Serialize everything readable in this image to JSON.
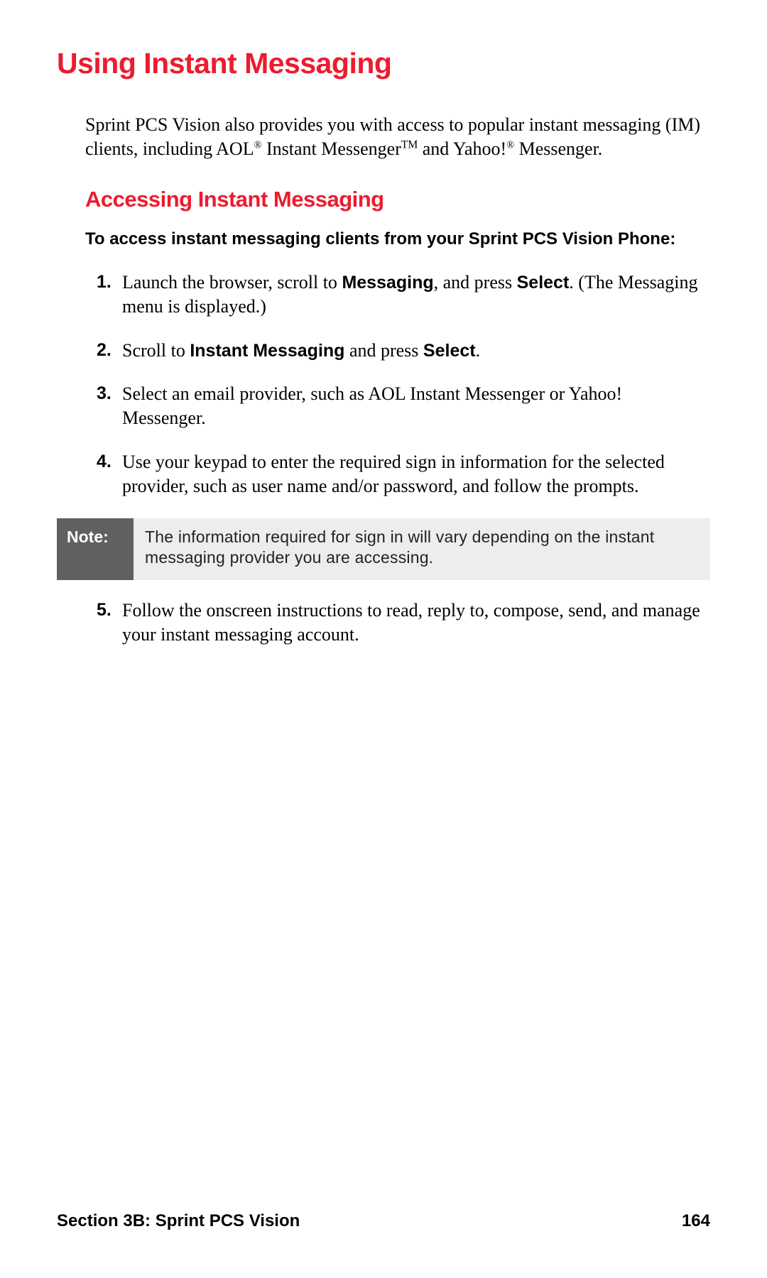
{
  "heading": "Using Instant Messaging",
  "intro_a": "Sprint PCS Vision also provides you with access to popular instant messaging (IM) clients, including AOL",
  "intro_b": " Instant Messenger",
  "intro_c": " and Yahoo!",
  "intro_d": " Messenger.",
  "reg": "®",
  "tm": "TM",
  "subheading": "Accessing Instant Messaging",
  "lead": "To access instant messaging clients from your Sprint PCS Vision Phone:",
  "nums": {
    "n1": "1.",
    "n2": "2.",
    "n3": "3.",
    "n4": "4.",
    "n5": "5."
  },
  "step1": {
    "a": "Launch the browser, scroll to ",
    "b": "Messaging",
    "c": ", and press ",
    "d": "Select",
    "e": ". (The Messaging menu is displayed.)"
  },
  "step2": {
    "a": "Scroll to ",
    "b": "Instant Messaging",
    "c": " and press ",
    "d": "Select",
    "e": "."
  },
  "step3": "Select an email provider, such as AOL Instant Messenger or Yahoo! Messenger.",
  "step4": "Use your keypad to enter the required sign in information for the selected provider, such as user name and/or password, and follow the prompts.",
  "note_label": "Note:",
  "note_body": "The information required for sign in will vary depending on the instant messaging provider you are accessing.",
  "step5": "Follow the onscreen instructions to read, reply to, compose, send, and manage your instant messaging account.",
  "footer_left": "Section 3B: Sprint PCS Vision",
  "footer_right": "164"
}
